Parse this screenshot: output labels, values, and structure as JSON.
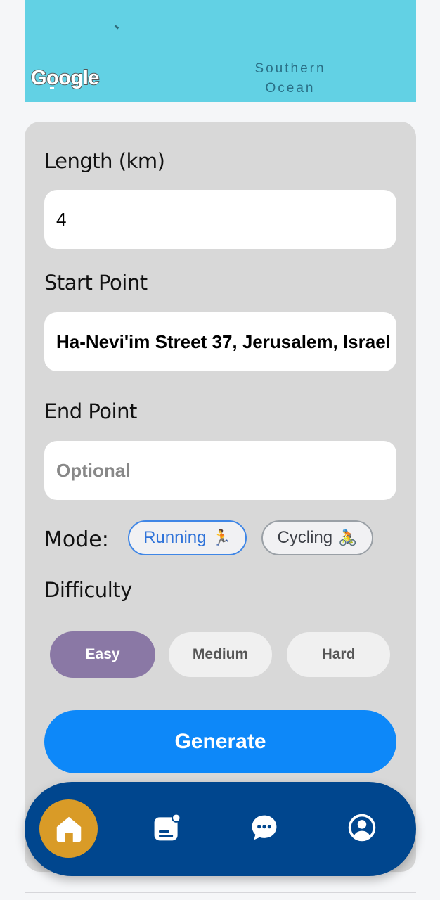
{
  "map": {
    "logo_text": "Google",
    "ocean_label_line1": "Southern",
    "ocean_label_line2": "Ocean",
    "water_color": "#62d1e4"
  },
  "form": {
    "length_label": "Length (km)",
    "length_value": "4",
    "start_label": "Start Point",
    "start_value": "Ha-Nevi'im Street 37, Jerusalem, Israel",
    "end_label": "End Point",
    "end_placeholder": "Optional",
    "end_value": "",
    "mode_label": "Mode:",
    "modes": [
      {
        "label": "Running",
        "emoji": "🏃",
        "selected": true
      },
      {
        "label": "Cycling",
        "emoji": "🚴",
        "selected": false
      }
    ],
    "difficulty_label": "Difficulty",
    "difficulties": [
      {
        "label": "Easy",
        "selected": true
      },
      {
        "label": "Medium",
        "selected": false
      },
      {
        "label": "Hard",
        "selected": false
      }
    ],
    "generate_label": "Generate"
  },
  "nav": {
    "items": [
      {
        "icon": "home-icon",
        "active": true
      },
      {
        "icon": "feed-icon",
        "active": false
      },
      {
        "icon": "chat-icon",
        "active": false
      },
      {
        "icon": "profile-icon",
        "active": false
      }
    ],
    "bar_color": "#00468e",
    "active_color": "#d99b27"
  },
  "colors": {
    "accent": "#0d88f9",
    "easy_selected": "#8a78a5",
    "running_selected": "#3f86e6"
  }
}
